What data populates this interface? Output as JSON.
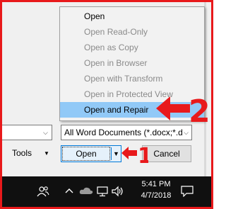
{
  "menu": {
    "items": [
      {
        "label": "Open",
        "state": "enabled"
      },
      {
        "label": "Open Read-Only",
        "state": "disabled"
      },
      {
        "label": "Open as Copy",
        "state": "disabled"
      },
      {
        "label": "Open in Browser",
        "state": "disabled"
      },
      {
        "label": "Open with Transform",
        "state": "disabled"
      },
      {
        "label": "Open in Protected View",
        "state": "disabled"
      },
      {
        "label": "Open and Repair",
        "state": "selected"
      }
    ]
  },
  "dialog": {
    "filename_value": "",
    "file_type_filter": "All Word Documents (*.docx;*.d",
    "tools_label": "Tools",
    "open_label": "Open",
    "cancel_label": "Cancel"
  },
  "annotations": {
    "marker_1": "1",
    "marker_2": "2",
    "color": "#e8191b"
  },
  "taskbar": {
    "time": "5:41 PM",
    "date": "4/7/2018",
    "icons": [
      "people-icon",
      "chevron-up-icon",
      "onedrive-icon",
      "network-icon",
      "volume-icon",
      "notifications-icon"
    ]
  },
  "colors": {
    "highlight": "#91c9f7",
    "primary_button_border": "#0078d7",
    "taskbar": "#101010"
  }
}
